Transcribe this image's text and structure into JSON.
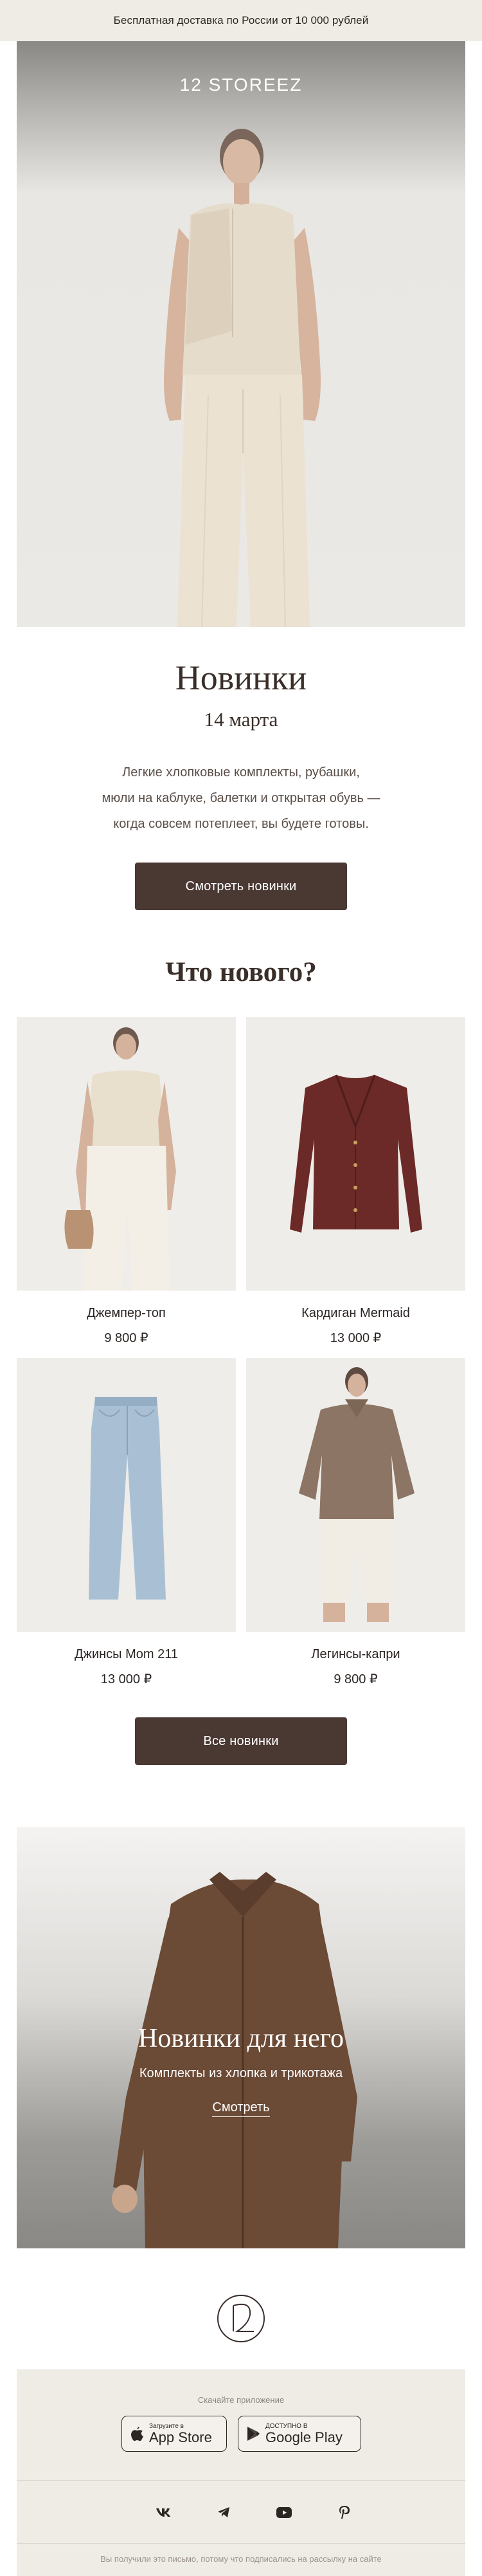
{
  "promo_bar": {
    "text": "Бесплатная доставка по России от 10 000 рублей"
  },
  "hero": {
    "logo": "12 STOREEZ"
  },
  "intro": {
    "title": "Новинки",
    "date": "14 марта",
    "lines": [
      "Легкие хлопковые комплекты, рубашки,",
      "мюли на каблуке, балетки и открытая обувь —",
      "когда совсем потеплеет, вы будете готовы."
    ],
    "cta": "Смотреть новинки"
  },
  "whats_new": {
    "title": "Что нового?",
    "products": [
      {
        "name": "Джемпер-топ",
        "price": "9 800 ₽"
      },
      {
        "name": "Кардиган Mermaid",
        "price": "13 000 ₽"
      },
      {
        "name": "Джинсы Mom 211",
        "price": "13 000 ₽"
      },
      {
        "name": "Легинсы-капри",
        "price": "9 800 ₽"
      }
    ],
    "cta": "Все новинки"
  },
  "men_banner": {
    "title": "Новинки для него",
    "subtitle": "Комплекты из хлопка и трикотажа",
    "link": "Смотреть"
  },
  "footer": {
    "download_label": "Скачайте приложение",
    "app_store": {
      "small": "Загрузите в",
      "big": "App Store"
    },
    "google_play": {
      "small": "ДОСТУПНО В",
      "big": "Google Play"
    },
    "social": [
      "vk-icon",
      "telegram-icon",
      "youtube-icon",
      "pinterest-icon"
    ],
    "legal": "Вы получили это письмо, потому что подписались на рассылку на сайте"
  },
  "colors": {
    "accent_button": "#4a3833",
    "promo_bg": "#efece6",
    "heading": "#3a2e29"
  }
}
